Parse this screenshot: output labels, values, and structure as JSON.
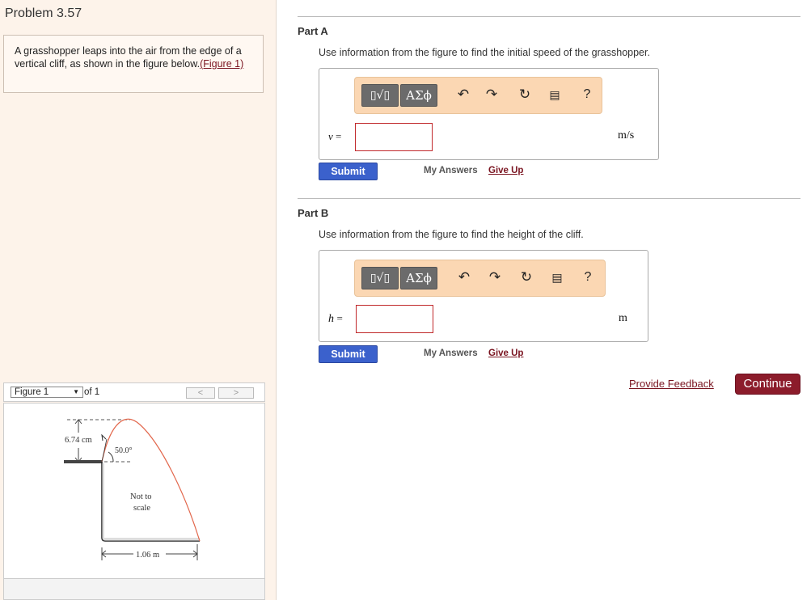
{
  "problem": {
    "title": "Problem 3.57",
    "text_before_link": "A grasshopper leaps into the air from the edge of a vertical cliff, as shown in the figure below.",
    "link_text": "(Figure 1)"
  },
  "figure_nav": {
    "selected": "Figure 1",
    "of_label": "of 1",
    "prev_label": "<",
    "next_label": ">",
    "figure": {
      "height_label": "6.74 cm",
      "angle_label": "50.0°",
      "scale_note_line1": "Not to",
      "scale_note_line2": "scale",
      "distance_label": "1.06 m"
    }
  },
  "toolbar": {
    "frac_label": "▯√▯",
    "greek_label": "ΑΣϕ",
    "undo_icon": "undo-icon",
    "redo_icon": "redo-icon",
    "reset_icon": "reset-icon",
    "keyboard_icon": "keyboard-icon",
    "help_label": "?"
  },
  "parts": [
    {
      "title": "Part A",
      "description": "Use information from the figure to find the initial speed of the grasshopper.",
      "variable": "v",
      "equals": "=",
      "input_value": "",
      "unit": "m/s",
      "submit_label": "Submit",
      "my_answers_label": "My Answers",
      "give_up_label": "Give Up"
    },
    {
      "title": "Part B",
      "description": "Use information from the figure to find the height of the cliff.",
      "variable": "h",
      "equals": "=",
      "input_value": "",
      "unit": "m",
      "submit_label": "Submit",
      "my_answers_label": "My Answers",
      "give_up_label": "Give Up"
    }
  ],
  "footer": {
    "feedback_label": "Provide Feedback",
    "continue_label": "Continue"
  },
  "colors": {
    "left_pane_bg": "#fdf3ea",
    "toolbar_bg": "#fbd7b3",
    "submit_bg": "#3b61cc",
    "continue_bg": "#8c1c2b",
    "link": "#7a1420",
    "trajectory": "#e2674c"
  }
}
